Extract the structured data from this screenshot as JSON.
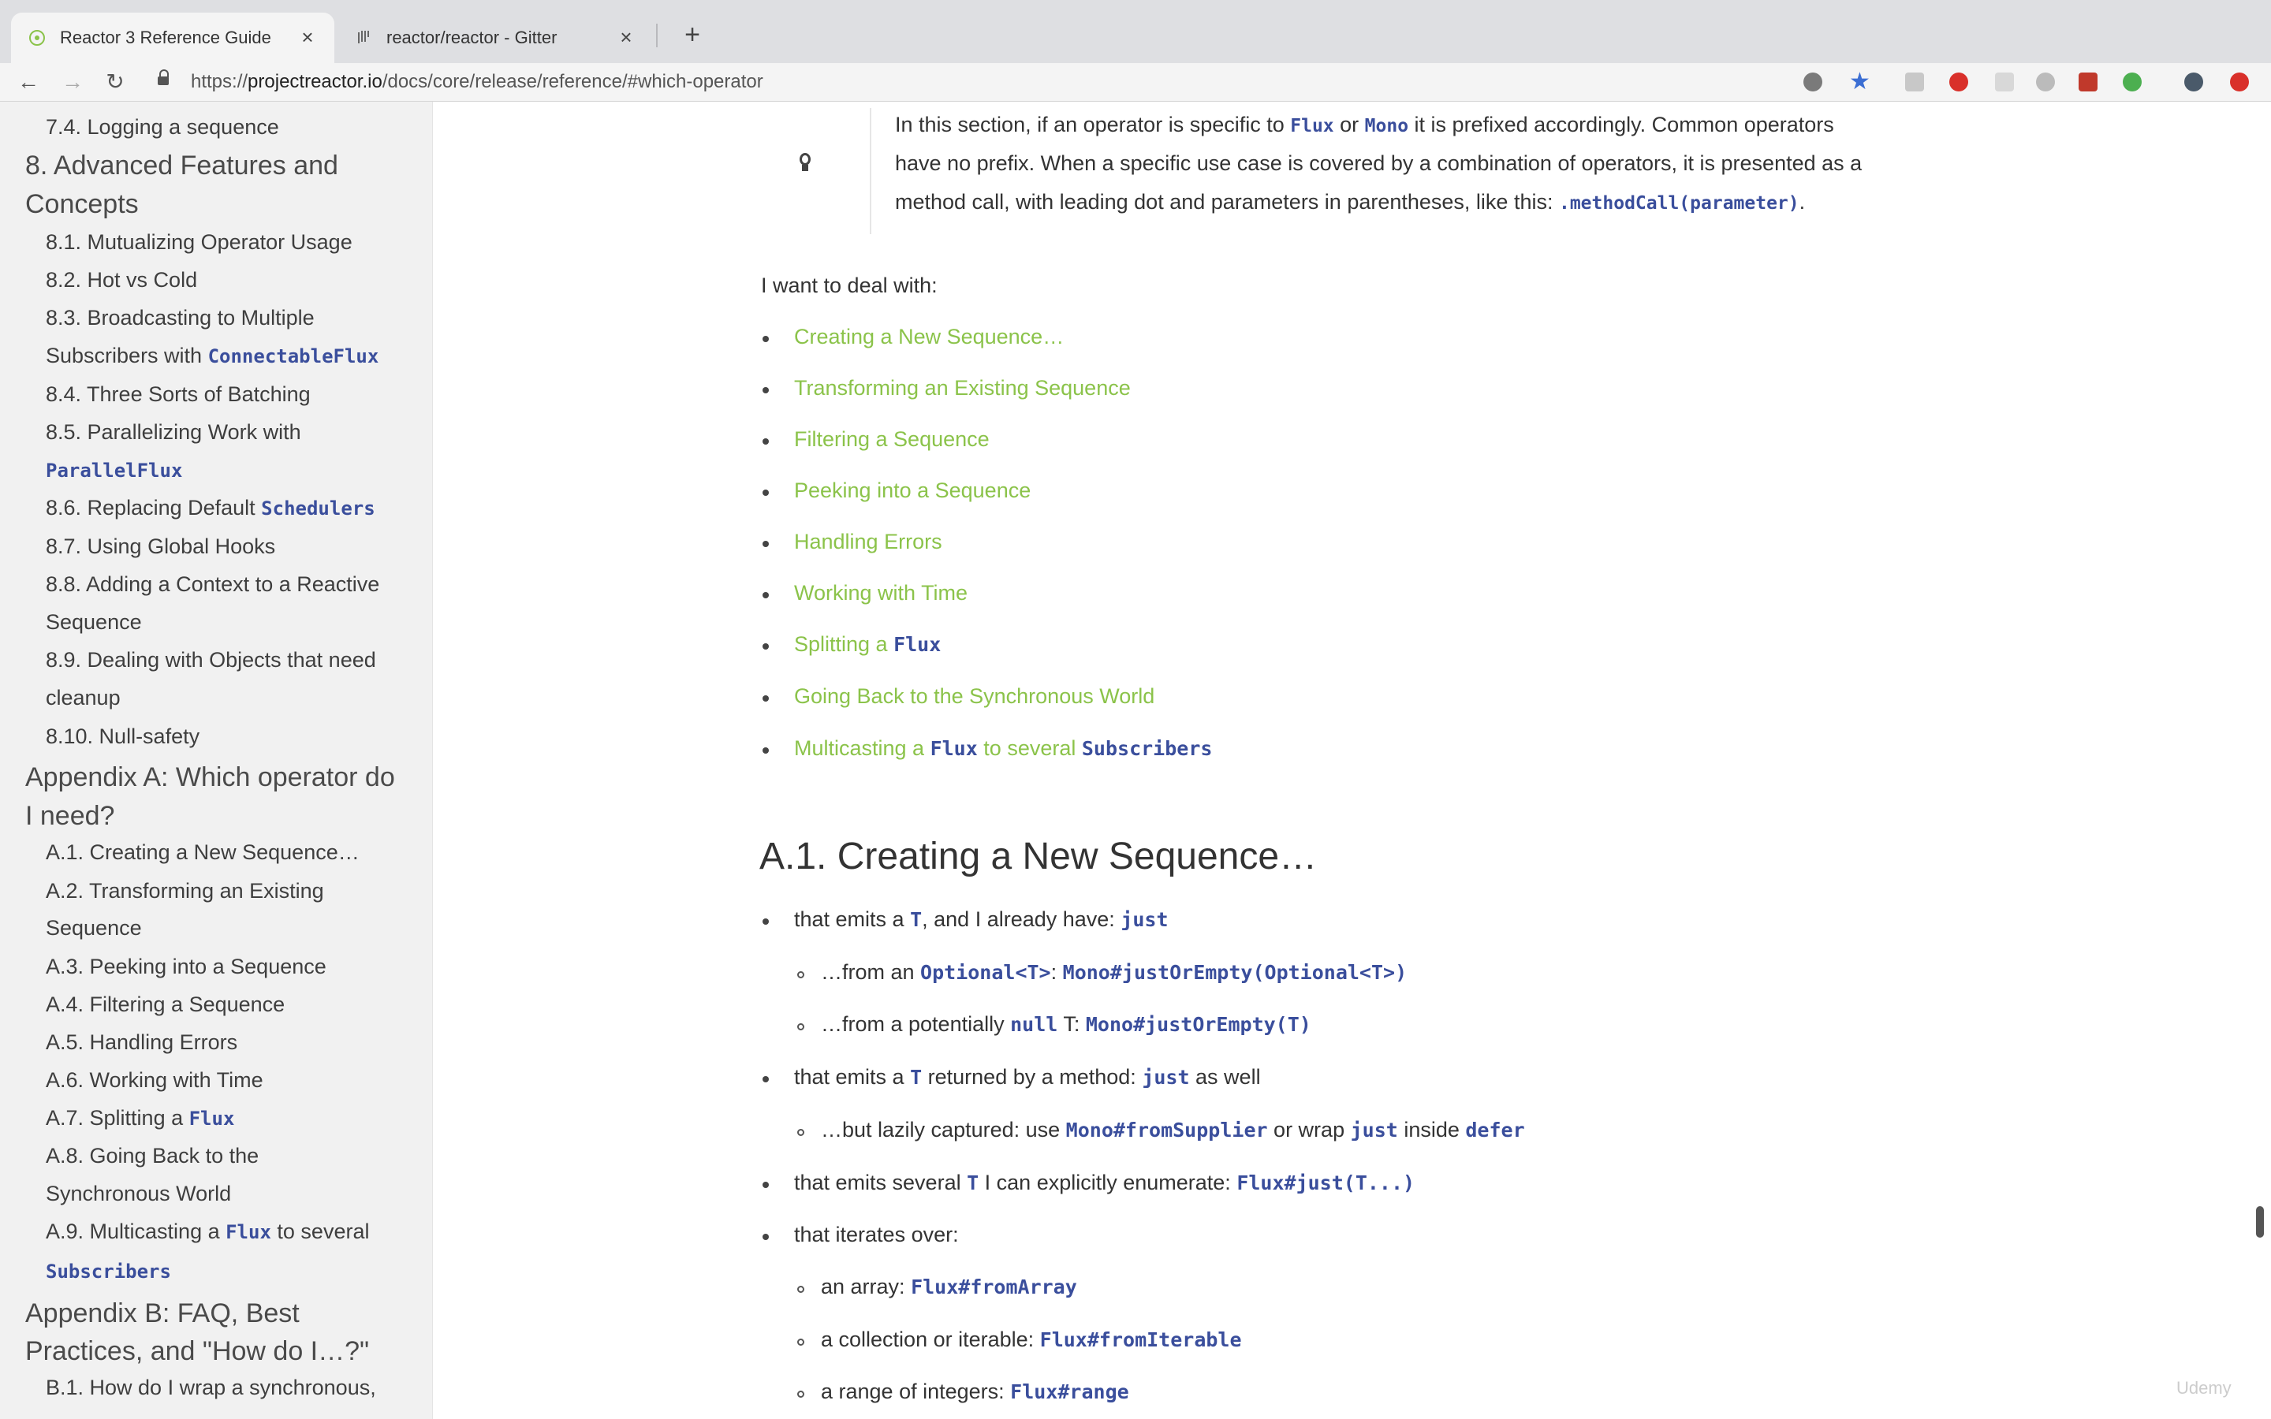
{
  "browser": {
    "tabs": [
      {
        "title": "Reactor 3 Reference Guide",
        "active": true,
        "icon": "reactor-icon"
      },
      {
        "title": "reactor/reactor - Gitter",
        "active": false,
        "icon": "gitter-icon"
      }
    ],
    "new_tab": "+",
    "close_glyph": "×",
    "url_scheme": "https://",
    "url_host": "projectreactor.io",
    "url_path": "/docs/core/release/reference/#which-operator"
  },
  "sidebar": {
    "items": [
      {
        "label": "7.4. Logging a sequence",
        "level": 2
      },
      {
        "label": "8. Advanced Features and",
        "level": 1
      },
      {
        "label": "Concepts",
        "level": 1
      },
      {
        "label": "8.1. Mutualizing Operator Usage",
        "level": 2
      },
      {
        "label": "8.2. Hot vs Cold",
        "level": 2
      },
      {
        "label": "8.3. Broadcasting to Multiple",
        "level": 2
      },
      {
        "label": "Subscribers with ",
        "code": "ConnectableFlux",
        "level": 2
      },
      {
        "label": "8.4. Three Sorts of Batching",
        "level": 2
      },
      {
        "label": "8.5. Parallelizing Work with",
        "level": 2
      },
      {
        "label": "",
        "code": "ParallelFlux",
        "level": 2
      },
      {
        "label": "8.6. Replacing Default ",
        "code": "Schedulers",
        "level": 2
      },
      {
        "label": "8.7. Using Global Hooks",
        "level": 2
      },
      {
        "label": "8.8. Adding a Context to a Reactive",
        "level": 2
      },
      {
        "label": "Sequence",
        "level": 2
      },
      {
        "label": "8.9. Dealing with Objects that need",
        "level": 2
      },
      {
        "label": "cleanup",
        "level": 2
      },
      {
        "label": "8.10. Null-safety",
        "level": 2
      },
      {
        "label": "Appendix A: Which operator do",
        "level": 1
      },
      {
        "label": "I need?",
        "level": 1
      },
      {
        "label": "A.1. Creating a New Sequence…",
        "level": 2
      },
      {
        "label": "A.2. Transforming an Existing",
        "level": 2
      },
      {
        "label": "Sequence",
        "level": 2
      },
      {
        "label": "A.3. Peeking into a Sequence",
        "level": 2
      },
      {
        "label": "A.4. Filtering a Sequence",
        "level": 2
      },
      {
        "label": "A.5. Handling Errors",
        "level": 2
      },
      {
        "label": "A.6. Working with Time",
        "level": 2
      },
      {
        "label": "A.7. Splitting a ",
        "code": "Flux",
        "level": 2
      },
      {
        "label": "A.8. Going Back to the",
        "level": 2
      },
      {
        "label": "Synchronous World",
        "level": 2
      },
      {
        "label": "A.9. Multicasting a ",
        "code": "Flux",
        "after": " to several",
        "level": 2
      },
      {
        "label": "",
        "code": "Subscribers",
        "level": 2
      },
      {
        "label": "Appendix B: FAQ, Best",
        "level": 1
      },
      {
        "label": "Practices, and \"How do I…?\"",
        "level": 1
      },
      {
        "label": "B.1. How do I wrap a synchronous,",
        "level": 2
      }
    ]
  },
  "tip": {
    "line1_a": "In this section, if an operator is specific to ",
    "line1_code1": "Flux",
    "line1_b": " or ",
    "line1_code2": "Mono",
    "line1_c": " it is prefixed accordingly. Common operators",
    "line2": "have no prefix. When a specific use case is covered by a combination of operators, it is presented as a",
    "line3_a": "method call, with leading dot and parameters in parentheses, like this: ",
    "line3_code": ".methodCall(parameter)",
    "line3_b": "."
  },
  "intro": "I want to deal with:",
  "links": [
    {
      "text": "Creating a New Sequence…"
    },
    {
      "text": "Transforming an Existing Sequence"
    },
    {
      "text": "Filtering a Sequence"
    },
    {
      "text": "Peeking into a Sequence"
    },
    {
      "text": "Handling Errors"
    },
    {
      "text": "Working with Time"
    },
    {
      "text": "Splitting a ",
      "code": "Flux"
    },
    {
      "text": "Going Back to the Synchronous World"
    },
    {
      "text": "Multicasting a ",
      "code": "Flux",
      "text2": " to several ",
      "code2": "Subscribers"
    }
  ],
  "section": {
    "heading": "A.1. Creating a New Sequence…",
    "items": [
      {
        "level": 1,
        "parts": [
          [
            "t",
            "that emits a "
          ],
          [
            "c",
            "T"
          ],
          [
            "t",
            ", and I already have: "
          ],
          [
            "c",
            "just"
          ]
        ]
      },
      {
        "level": 2,
        "parts": [
          [
            "t",
            "…from an "
          ],
          [
            "c",
            "Optional<T>"
          ],
          [
            "t",
            ": "
          ],
          [
            "c",
            "Mono#justOrEmpty(Optional<T>)"
          ]
        ]
      },
      {
        "level": 2,
        "parts": [
          [
            "t",
            "…from a potentially "
          ],
          [
            "c",
            "null"
          ],
          [
            "t",
            " T: "
          ],
          [
            "c",
            "Mono#justOrEmpty(T)"
          ]
        ]
      },
      {
        "level": 1,
        "parts": [
          [
            "t",
            "that emits a "
          ],
          [
            "c",
            "T"
          ],
          [
            "t",
            " returned by a method: "
          ],
          [
            "c",
            "just"
          ],
          [
            "t",
            " as well"
          ]
        ]
      },
      {
        "level": 2,
        "parts": [
          [
            "t",
            "…but lazily captured: use "
          ],
          [
            "c",
            "Mono#fromSupplier"
          ],
          [
            "t",
            " or wrap "
          ],
          [
            "c",
            "just"
          ],
          [
            "t",
            " inside "
          ],
          [
            "c",
            "defer"
          ]
        ]
      },
      {
        "level": 1,
        "parts": [
          [
            "t",
            "that emits several "
          ],
          [
            "c",
            "T"
          ],
          [
            "t",
            " I can explicitly enumerate: "
          ],
          [
            "c",
            "Flux#just(T...)"
          ]
        ]
      },
      {
        "level": 1,
        "parts": [
          [
            "t",
            "that iterates over:"
          ]
        ]
      },
      {
        "level": 2,
        "parts": [
          [
            "t",
            "an array: "
          ],
          [
            "c",
            "Flux#fromArray"
          ]
        ]
      },
      {
        "level": 2,
        "parts": [
          [
            "t",
            "a collection or iterable: "
          ],
          [
            "c",
            "Flux#fromIterable"
          ]
        ]
      },
      {
        "level": 2,
        "parts": [
          [
            "t",
            "a range of integers: "
          ],
          [
            "c",
            "Flux#range"
          ]
        ]
      }
    ]
  },
  "colors": {
    "link": "#8bc34a",
    "code": "#3a4e9c",
    "sidebar_bg": "#f1f1f1"
  },
  "watermark": "Udemy"
}
